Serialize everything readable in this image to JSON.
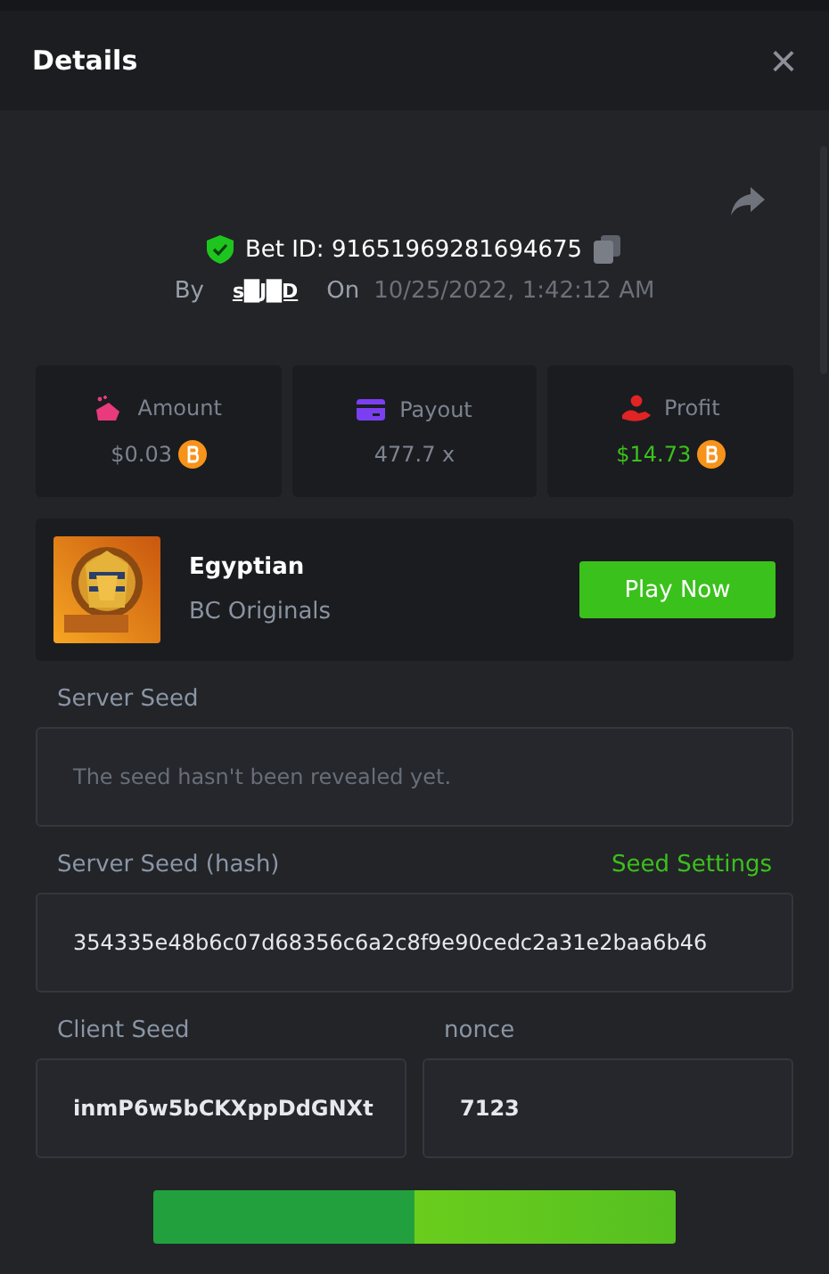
{
  "dialog": {
    "title": "Details",
    "close": "×"
  },
  "bet": {
    "id_label": "Bet ID: 91651969281694675",
    "by_label": "By",
    "user": "s█J█D",
    "on_label": "On",
    "date": "10/25/2022, 1:42:12 AM"
  },
  "stats": [
    {
      "kind": "amount",
      "label": "Amount",
      "value": "$0.03",
      "coin": true,
      "color": "#e83a7d"
    },
    {
      "kind": "payout",
      "label": "Payout",
      "value": "477.7 x",
      "coin": false,
      "color": "#7b3ff2"
    },
    {
      "kind": "profit",
      "label": "Profit",
      "value": "$14.73",
      "coin": true,
      "color": "#e02424"
    }
  ],
  "game": {
    "name": "Egyptian",
    "provider": "BC Originals",
    "kind": "picture",
    "button": "Play Now"
  },
  "fields": [
    {
      "label": "Server Seed",
      "placeholder": "The seed hasn't been revealed yet."
    },
    {
      "label": "Server Seed (hash)",
      "link": "Seed Settings",
      "value": "354335e48b6c07d68356c6a2c8f9e90cedc2a31e2baa6b46"
    }
  ],
  "pair": [
    {
      "label": "Client Seed",
      "value": "inmP6w5bCKXppDdGNXt"
    },
    {
      "label": "nonce",
      "value": "7123"
    }
  ]
}
